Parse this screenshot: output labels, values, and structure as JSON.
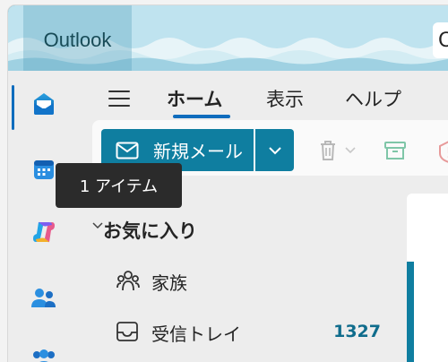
{
  "app": {
    "title": "Outlook",
    "search_fragment": "C"
  },
  "colors": {
    "brand": "#0f7ea0",
    "accent_blue": "#0f6cbd",
    "count": "#0f6c8c",
    "tooltip_bg": "#2b2b2b"
  },
  "rail": {
    "items": [
      {
        "name": "mail",
        "icon": "mail-icon"
      },
      {
        "name": "calendar",
        "icon": "calendar-icon"
      },
      {
        "name": "copilot",
        "icon": "copilot-icon"
      },
      {
        "name": "people",
        "icon": "people-icon"
      },
      {
        "name": "groups",
        "icon": "groups-icon"
      }
    ]
  },
  "ribbon": {
    "tabs": [
      {
        "label": "ホーム",
        "active": true
      },
      {
        "label": "表示",
        "active": false
      },
      {
        "label": "ヘルプ",
        "active": false
      }
    ]
  },
  "toolbar": {
    "new_mail_label": "新規メール"
  },
  "tooltip": {
    "text": "1 アイテム"
  },
  "folders": {
    "favorites_label": "お気に入り",
    "items": [
      {
        "label": "家族",
        "icon": "group-folder-icon",
        "count": ""
      },
      {
        "label": "受信トレイ",
        "icon": "inbox-icon",
        "count": "1327"
      }
    ]
  }
}
